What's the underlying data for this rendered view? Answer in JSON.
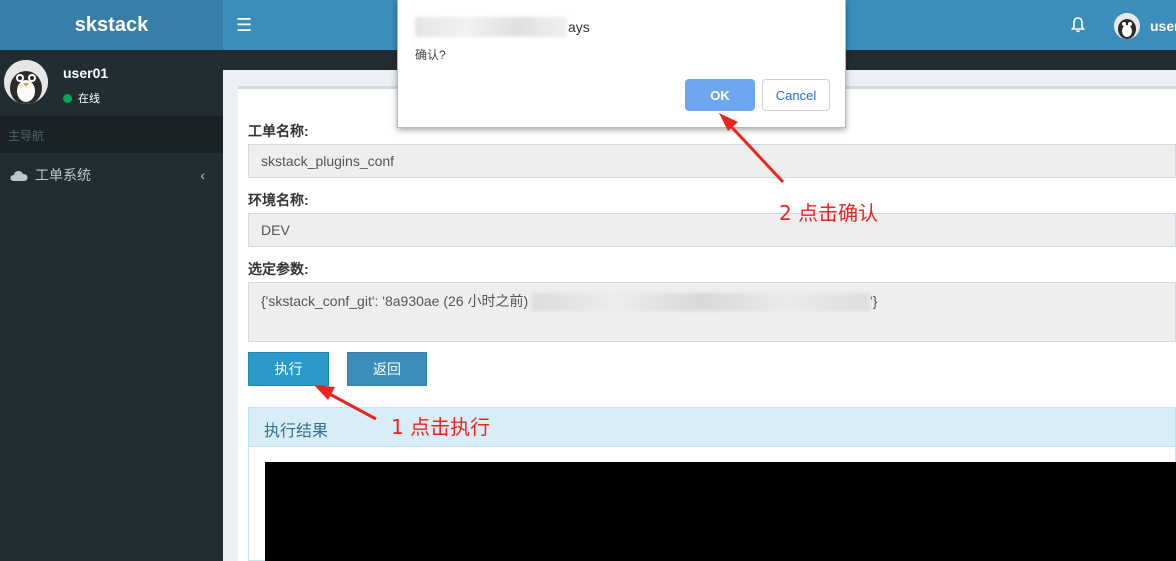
{
  "header": {
    "app_title": "skstack",
    "menu_icon": "hamburger-icon",
    "user_name": "user"
  },
  "sidebar": {
    "user_name": "user01",
    "status": "在线",
    "nav_header": "主导航",
    "items": [
      {
        "icon": "cloud-icon",
        "label": "工单系统"
      }
    ]
  },
  "form": {
    "ticket_label": "工单名称:",
    "ticket_value": "skstack_plugins_conf",
    "env_label": "环境名称:",
    "env_value": "DEV",
    "params_label": "选定参数:",
    "params_value_start": "{'skstack_conf_git': '8a930ae (26 小时之前)",
    "params_value_end": "'}",
    "execute_button": "执行",
    "back_button": "返回"
  },
  "result": {
    "title": "执行结果"
  },
  "dialog": {
    "title_suffix": "ays",
    "message": "确认?",
    "ok_button": "OK",
    "cancel_button": "Cancel"
  },
  "annotations": {
    "step1": "1 点击执行",
    "step2": "2 点击确认",
    "color": "#e8261f"
  },
  "colors": {
    "navbar": "#3c8dbc",
    "logo_bg": "#367fa9",
    "sidebar": "#222d32",
    "ok_button": "#6ea6f0"
  }
}
